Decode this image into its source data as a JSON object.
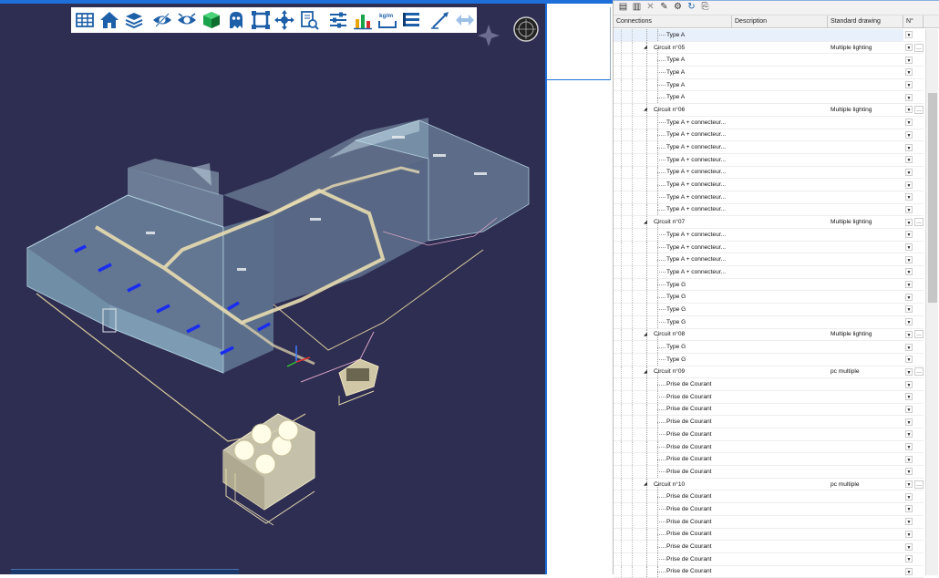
{
  "toolbar": {
    "icons": [
      "grid-icon",
      "home-icon",
      "layers-icon",
      "eye-hidden-icon",
      "eye-show-icon",
      "cube-color-icon",
      "ghost-icon",
      "frame-icon",
      "move-axis-icon",
      "document-view-icon",
      "sliders-icon",
      "bar-chart-icon",
      "kg-m-icon",
      "list-icon",
      "arrow-measure-icon",
      "double-arrow-icon"
    ],
    "kgm_label": "kg/m"
  },
  "panel": {
    "columns": {
      "connections": "Connections",
      "description": "Description",
      "standard_drawing": "Standard drawing",
      "n": "N°"
    },
    "rows": [
      {
        "label": "Type A",
        "level": 2,
        "std": "",
        "selected": true
      },
      {
        "label": "Circuit n°05",
        "level": 1,
        "std": "Multiple lighting"
      },
      {
        "label": "Type A",
        "level": 2,
        "std": ""
      },
      {
        "label": "Type A",
        "level": 2,
        "std": ""
      },
      {
        "label": "Type A",
        "level": 2,
        "std": ""
      },
      {
        "label": "Type A",
        "level": 2,
        "std": ""
      },
      {
        "label": "Circuit n°06",
        "level": 1,
        "std": "Multiple lighting"
      },
      {
        "label": "Type A + connecteur...",
        "level": 2,
        "std": ""
      },
      {
        "label": "Type A + connecteur...",
        "level": 2,
        "std": ""
      },
      {
        "label": "Type A + connecteur...",
        "level": 2,
        "std": ""
      },
      {
        "label": "Type A + connecteur...",
        "level": 2,
        "std": ""
      },
      {
        "label": "Type A + connecteur...",
        "level": 2,
        "std": ""
      },
      {
        "label": "Type A + connecteur...",
        "level": 2,
        "std": ""
      },
      {
        "label": "Type A + connecteur...",
        "level": 2,
        "std": ""
      },
      {
        "label": "Type A + connecteur...",
        "level": 2,
        "std": ""
      },
      {
        "label": "Circuit n°07",
        "level": 1,
        "std": "Multiple lighting"
      },
      {
        "label": "Type A + connecteur...",
        "level": 2,
        "std": ""
      },
      {
        "label": "Type A + connecteur...",
        "level": 2,
        "std": ""
      },
      {
        "label": "Type A + connecteur...",
        "level": 2,
        "std": ""
      },
      {
        "label": "Type A + connecteur...",
        "level": 2,
        "std": ""
      },
      {
        "label": "Type G",
        "level": 2,
        "std": ""
      },
      {
        "label": "Type G",
        "level": 2,
        "std": ""
      },
      {
        "label": "Type G",
        "level": 2,
        "std": ""
      },
      {
        "label": "Type G",
        "level": 2,
        "std": ""
      },
      {
        "label": "Circuit n°08",
        "level": 1,
        "std": "Multiple lighting"
      },
      {
        "label": "Type G",
        "level": 2,
        "std": ""
      },
      {
        "label": "Type G",
        "level": 2,
        "std": ""
      },
      {
        "label": "Circuit n°09",
        "level": 1,
        "std": "pc multiple"
      },
      {
        "label": "Prise de Courant",
        "level": 2,
        "std": ""
      },
      {
        "label": "Prise de Courant",
        "level": 2,
        "std": ""
      },
      {
        "label": "Prise de Courant",
        "level": 2,
        "std": ""
      },
      {
        "label": "Prise de Courant",
        "level": 2,
        "std": ""
      },
      {
        "label": "Prise de Courant",
        "level": 2,
        "std": ""
      },
      {
        "label": "Prise de Courant",
        "level": 2,
        "std": ""
      },
      {
        "label": "Prise de Courant",
        "level": 2,
        "std": ""
      },
      {
        "label": "Prise de Courant",
        "level": 2,
        "std": ""
      },
      {
        "label": "Circuit n°10",
        "level": 1,
        "std": "pc multiple"
      },
      {
        "label": "Prise de Courant",
        "level": 2,
        "std": ""
      },
      {
        "label": "Prise de Courant",
        "level": 2,
        "std": ""
      },
      {
        "label": "Prise de Courant",
        "level": 2,
        "std": ""
      },
      {
        "label": "Prise de Courant",
        "level": 2,
        "std": ""
      },
      {
        "label": "Prise de Courant",
        "level": 2,
        "std": ""
      },
      {
        "label": "Prise de Courant",
        "level": 2,
        "std": ""
      },
      {
        "label": "Prise de Courant",
        "level": 2,
        "std": ""
      }
    ],
    "tools": [
      "panel-view-icon",
      "panel-list-icon",
      "delete-icon",
      "edit-icon",
      "settings-icon",
      "refresh-icon",
      "export-icon"
    ]
  },
  "colors": {
    "viewport_bg": "#2e2d52",
    "accent": "#1e6fd9",
    "cable": "#e8dcb0",
    "fixture": "#1a2cf0"
  }
}
